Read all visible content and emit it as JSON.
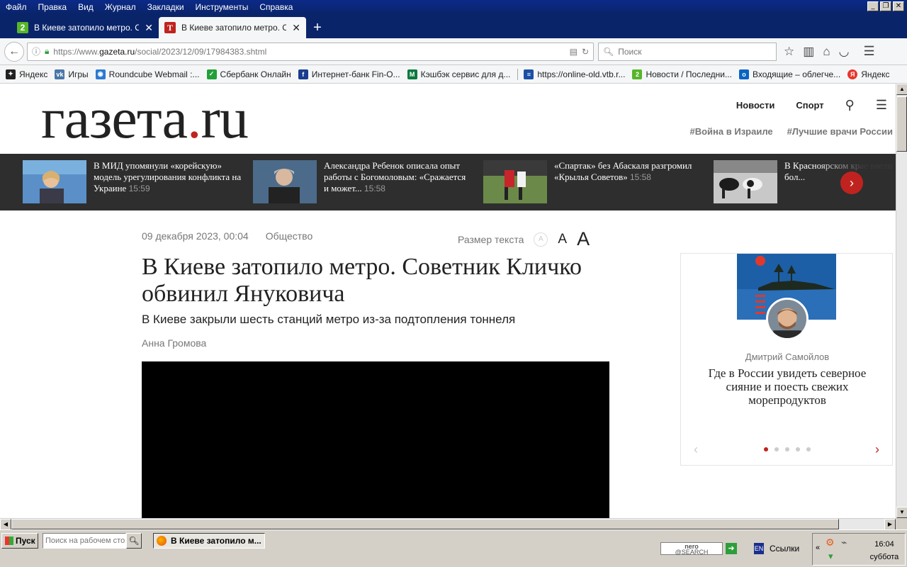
{
  "menubar": {
    "items": [
      "Файл",
      "Правка",
      "Вид",
      "Журнал",
      "Закладки",
      "Инструменты",
      "Справка"
    ]
  },
  "tabs": [
    {
      "title": "В Киеве затопило метро. Со...",
      "icon": "green-2-icon"
    },
    {
      "title": "В Киеве затопило метро. Со...",
      "icon": "gazeta-t-icon"
    }
  ],
  "navbar": {
    "url_prefix": "https://www.",
    "url_host": "gazeta.ru",
    "url_path": "/social/2023/12/09/17984383.shtml",
    "search_placeholder": "Поиск"
  },
  "bookmarks": [
    {
      "label": "Яндекс",
      "icon": "yandex-star-icon",
      "color": "#222222"
    },
    {
      "label": "Игры",
      "icon": "vk-icon",
      "color": "#4a76a8"
    },
    {
      "label": "Roundcube Webmail :...",
      "icon": "roundcube-icon",
      "color": "#2b7bd1"
    },
    {
      "label": "Сбербанк Онлайн",
      "icon": "sberbank-icon",
      "color": "#21a038"
    },
    {
      "label": "Интернет-банк Fin-O...",
      "icon": "fin-icon",
      "color": "#1a3d8f"
    },
    {
      "label": "Кэшбэк сервис для д...",
      "icon": "cashback-m-icon",
      "color": "#0a7a3d"
    },
    {
      "label": "https://online-old.vtb.r...",
      "icon": "vtb-icon",
      "color": "#1d4fa5"
    },
    {
      "label": "Новости / Последни...",
      "icon": "green-2-icon",
      "color": "#57b52a"
    },
    {
      "label": "Входящие – облегче...",
      "icon": "outlook-icon",
      "color": "#0a64c2"
    },
    {
      "label": "Яндекс",
      "icon": "yandex-y-icon",
      "color": "#e6362c"
    }
  ],
  "site": {
    "logo_main": "газета",
    "logo_dot": ".",
    "logo_tld": "ru",
    "nav": [
      "Новости",
      "Спорт"
    ],
    "tags": [
      "#Война в Израиле",
      "#Лучшие врачи России"
    ]
  },
  "strip": [
    {
      "text": "В МИД упомянули «корейскую» модель урегулирования конфликта на Украине",
      "time": "15:59"
    },
    {
      "text": "Александра Ребенок описала опыт работы с Богомоловым: «Сражается и может...",
      "time": "15:58"
    },
    {
      "text": "«Спартак» без Абаскаля разгромил «Крылья Советов»",
      "time": "15:58"
    },
    {
      "text": "В Красноярском крае ввели ЧС из-за бол...",
      "time": ""
    }
  ],
  "article": {
    "date": "09 декабря 2023, 00:04",
    "rubric": "Общество",
    "size_label": "Размер текста",
    "size_small": "A",
    "size_medium": "A",
    "size_large": "A",
    "title": "В Киеве затопило метро. Советник Кличко обвинил Януковича",
    "subtitle": "В Киеве закрыли шесть станций метро из-за подтопления тоннеля",
    "author": "Анна Громова"
  },
  "card": {
    "author": "Дмитрий Самойлов",
    "title": "Где в России увидеть северное сияние и поесть свежих морепродуктов",
    "dots_total": 5,
    "dots_active": 1
  },
  "taskbar": {
    "start": "Пуск",
    "search_placeholder": "Поиск на рабочем сто",
    "task_title": "В Киеве затопило м...",
    "nero": "nero",
    "nero_sub": "@SEARCH",
    "lang": "EN",
    "links": "Ссылки",
    "time": "16:04",
    "day": "суббота"
  },
  "colors": {
    "accent": "#c0231f",
    "strip_bg": "#2e2e2e",
    "titlebar": "#0a246a"
  }
}
